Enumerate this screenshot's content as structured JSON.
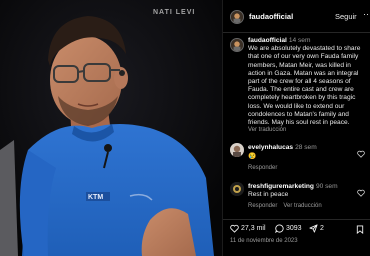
{
  "photo": {
    "watermark": "NATI LEVI",
    "shirt_logo": "KTM"
  },
  "header": {
    "username": "faudaofficial",
    "follow_label": "Seguir"
  },
  "caption": {
    "username": "faudaofficial",
    "time": "14 sem",
    "text": "We are absolutely devastated to share that one of our very own Fauda family members, Matan Meir, was killed in action in Gaza. Matan was an integral part of the crew for all 4 seasons of Fauda. The entire cast and crew are completely heartbroken by this tragic loss. We would like to extend our condolences to Matan's family and friends. May his soul rest in peace.",
    "translate_label": "Ver traducción"
  },
  "comments": [
    {
      "username": "evelynhalucas",
      "time": "28 sem",
      "body": "😢",
      "reply_label": "Responder",
      "translate_label": ""
    },
    {
      "username": "freshfiguremarketing",
      "time": "90 sem",
      "body": "Rest in peace",
      "reply_label": "Responder",
      "translate_label": "Ver traducción"
    }
  ],
  "actions": {
    "likes": "27,3 mil",
    "comments": "3093",
    "shares": "2"
  },
  "date": "11 de noviembre de 2023",
  "colors": {
    "background": "#000000",
    "shirt": "#2a69c4",
    "muted_text": "#9a9a9a"
  }
}
